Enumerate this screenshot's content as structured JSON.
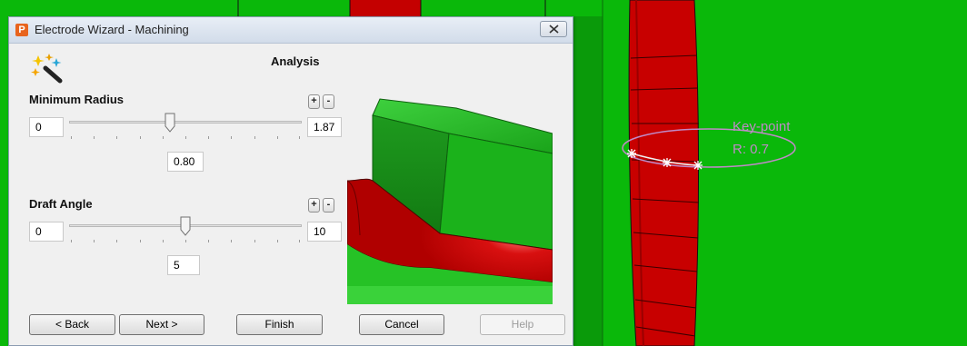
{
  "window": {
    "title": "Electrode Wizard - Machining",
    "app_icon_letter": "P"
  },
  "page": {
    "heading": "Analysis"
  },
  "minimum_radius": {
    "label": "Minimum Radius",
    "min": "0",
    "max": "1.87",
    "value": "0.80",
    "slider_fraction": 0.43,
    "plus_label": "+",
    "minus_label": "-"
  },
  "draft_angle": {
    "label": "Draft Angle",
    "min": "0",
    "max": "10",
    "value": "5",
    "slider_fraction": 0.5,
    "plus_label": "+",
    "minus_label": "-"
  },
  "buttons": {
    "back": "< Back",
    "next": "Next >",
    "finish": "Finish",
    "cancel": "Cancel",
    "help": "Help"
  },
  "viewport": {
    "keypoint_label": "Key-point",
    "radius_label": "R: 0.7",
    "colors": {
      "background": "#0ab80a",
      "electrode_red": "#c00000",
      "annotation": "#c08ac8"
    }
  }
}
